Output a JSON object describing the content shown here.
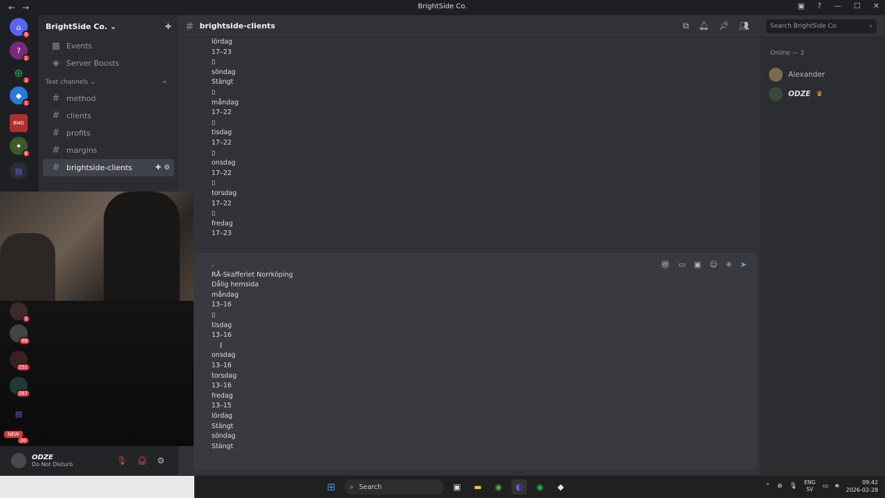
{
  "window": {
    "title": "BrightSide Co.",
    "back": "←",
    "forward": "→",
    "controls": [
      "▣",
      "?",
      "—",
      "☐",
      "✕"
    ]
  },
  "guilds": [
    {
      "label": "⌂",
      "badge": "6",
      "color": "#5865f2"
    },
    {
      "label": "?",
      "badge": "1",
      "color": "#7a2a7a"
    },
    {
      "label": "⊕",
      "badge": "1",
      "color": "#1e1f22"
    },
    {
      "label": "◆",
      "badge": "1",
      "color": "#2a7ad8"
    },
    {
      "label": "BNG",
      "badge": "",
      "color": "#b03030"
    },
    {
      "label": "✦",
      "badge": "6",
      "color": "#3a5a2a"
    },
    {
      "label": "▤",
      "badge": "",
      "color": "#2b2d31"
    }
  ],
  "lower_guilds": [
    {
      "badge": "3"
    },
    {
      "badge": "98"
    },
    {
      "badge": "251"
    },
    {
      "badge": "287"
    },
    {
      "badge": "30",
      "new_label": "NEW"
    }
  ],
  "sidebar": {
    "server_name": "BrightSide Co.",
    "top_items": [
      {
        "icon": "calendar-icon",
        "glyph": "▦",
        "label": "Events"
      },
      {
        "icon": "boost-icon",
        "glyph": "◈",
        "label": "Server Boosts"
      }
    ],
    "category": "Text channels",
    "channels": [
      {
        "label": "method"
      },
      {
        "label": "clients"
      },
      {
        "label": "profits"
      },
      {
        "label": "margins"
      },
      {
        "label": "brightside-clients",
        "active": true
      }
    ]
  },
  "header": {
    "channel": "brightside-clients",
    "search_placeholder": "Search BrightSide Co."
  },
  "messages": {
    "lines": [
      "lördag",
      "17–23",
      "▯",
      "söndag",
      "Stängt",
      "▯",
      "måndag",
      "17–22",
      "▯",
      "tisdag",
      "17–22",
      "▯",
      "onsdag",
      "17–22",
      "▯",
      "torsdag",
      "17–22",
      "▯",
      "fredag",
      "17–23"
    ]
  },
  "composer": {
    "lines": [
      ".",
      "RÅ-Skafferiet Norrköping",
      "Dålig hemsida",
      "måndag",
      "13–16",
      "▯",
      "tisdag",
      "13–16",
      "",
      "onsdag",
      "13–16",
      "torsdag",
      "13–16",
      "fredag",
      "13–15",
      "lördag",
      "Stängt",
      "söndag",
      "Stängt"
    ]
  },
  "members": {
    "heading": "Online — 2",
    "list": [
      {
        "name": "Alexander",
        "color": "#b5bac1",
        "crown": ""
      },
      {
        "name": "ODZE",
        "color": "#dbdee1",
        "crown": "♛"
      }
    ]
  },
  "user": {
    "name": "ODZE",
    "status": "Do Not Disturb"
  },
  "taskbar": {
    "search_label": "Search",
    "lang_top": "ENG",
    "lang_bottom": "SV",
    "time": "09:42",
    "date": "2026-02-28"
  },
  "colors": {
    "accent": "#5865f2",
    "dnd": "#f23f43"
  }
}
